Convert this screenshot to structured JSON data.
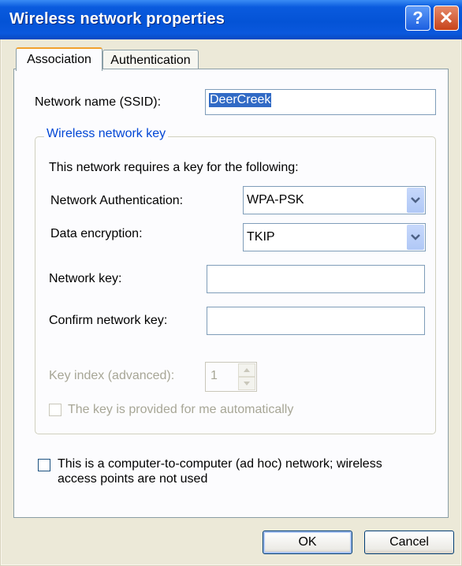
{
  "window": {
    "title": "Wireless network properties"
  },
  "tabs": [
    {
      "label": "Association",
      "active": true
    },
    {
      "label": "Authentication",
      "active": false
    }
  ],
  "ssid": {
    "label": "Network name (SSID):",
    "value": "DeerCreek"
  },
  "key_group": {
    "legend": "Wireless network key",
    "intro": "This network requires a key for the following:",
    "auth_label": "Network Authentication:",
    "auth_value": "WPA-PSK",
    "encryption_label": "Data encryption:",
    "encryption_value": "TKIP",
    "network_key_label": "Network key:",
    "network_key_value": "",
    "confirm_key_label": "Confirm network key:",
    "confirm_key_value": "",
    "key_index_label": "Key index (advanced):",
    "key_index_value": "1",
    "auto_key_label": "The key is provided for me automatically"
  },
  "adhoc": {
    "line1": "This is a computer-to-computer (ad hoc) network; wireless",
    "line2": "access points are not used"
  },
  "buttons": {
    "ok": "OK",
    "cancel": "Cancel"
  },
  "icons": {
    "help": "help-icon",
    "close": "close-icon",
    "dropdown": "chevron-down-icon"
  },
  "colors": {
    "titlebar": "#0453d6",
    "legend": "#0046d5",
    "selection": "#316ac5"
  }
}
